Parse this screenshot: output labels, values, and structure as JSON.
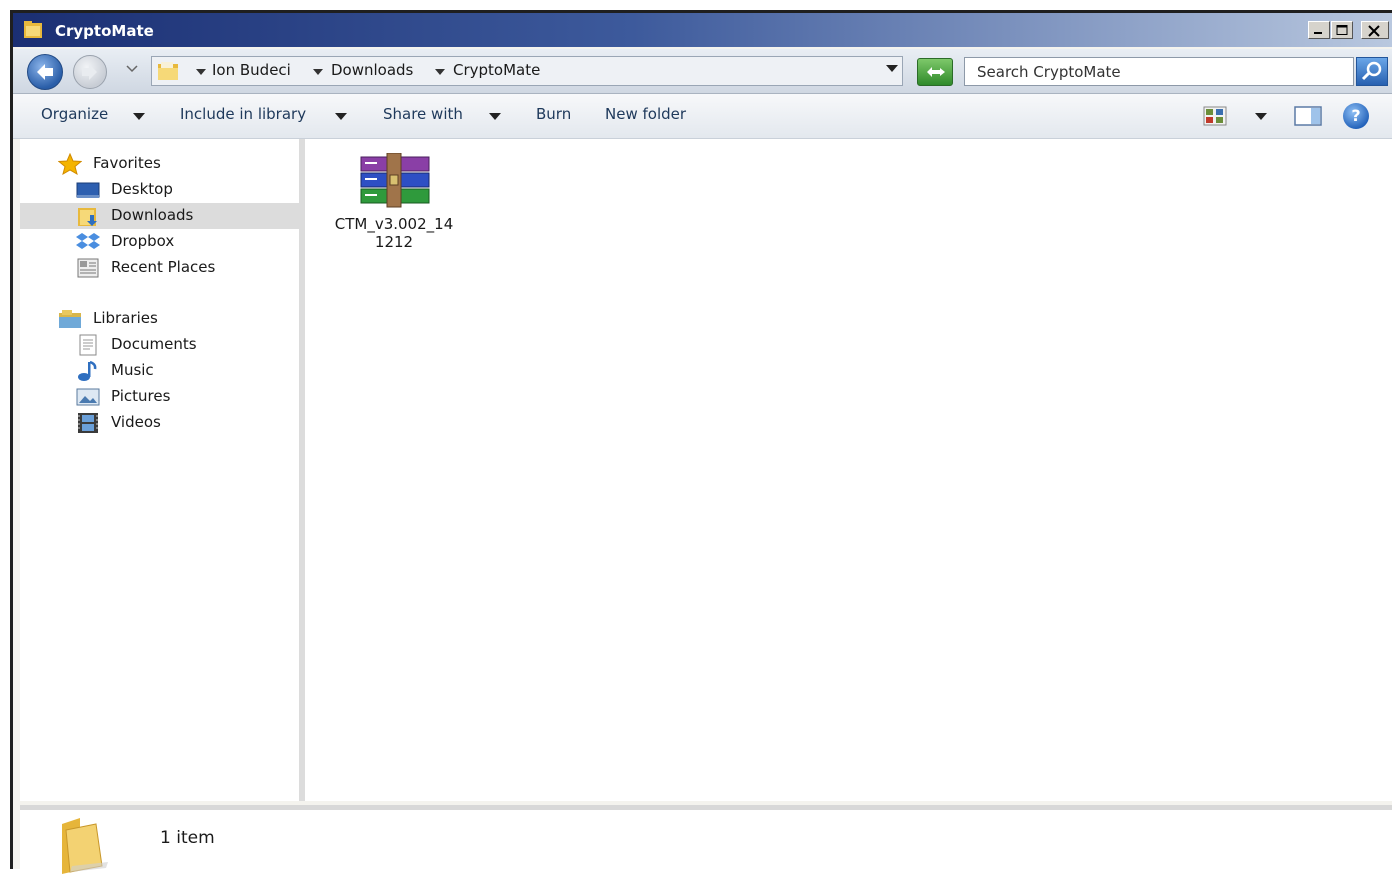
{
  "window": {
    "title": "CryptoMate"
  },
  "address": {
    "breadcrumbs": [
      "Ion Budeci",
      "Downloads",
      "CryptoMate"
    ],
    "search_placeholder": "Search CryptoMate"
  },
  "toolbar": {
    "organize": "Organize",
    "include_in_library": "Include in library",
    "share_with": "Share with",
    "burn": "Burn",
    "new_folder": "New folder"
  },
  "nav": {
    "favorites": "Favorites",
    "desktop": "Desktop",
    "downloads": "Downloads",
    "dropbox": "Dropbox",
    "recent_places": "Recent Places",
    "libraries": "Libraries",
    "documents": "Documents",
    "music": "Music",
    "pictures": "Pictures",
    "videos": "Videos"
  },
  "files": [
    {
      "name": "CTM_v3.002_141212",
      "icon": "winrar-archive-icon"
    }
  ],
  "status": {
    "item_count": "1 item"
  },
  "colors": {
    "titlebar": "#1b2f73",
    "command_text": "#1e395b",
    "selection": "#dcdcdc"
  }
}
